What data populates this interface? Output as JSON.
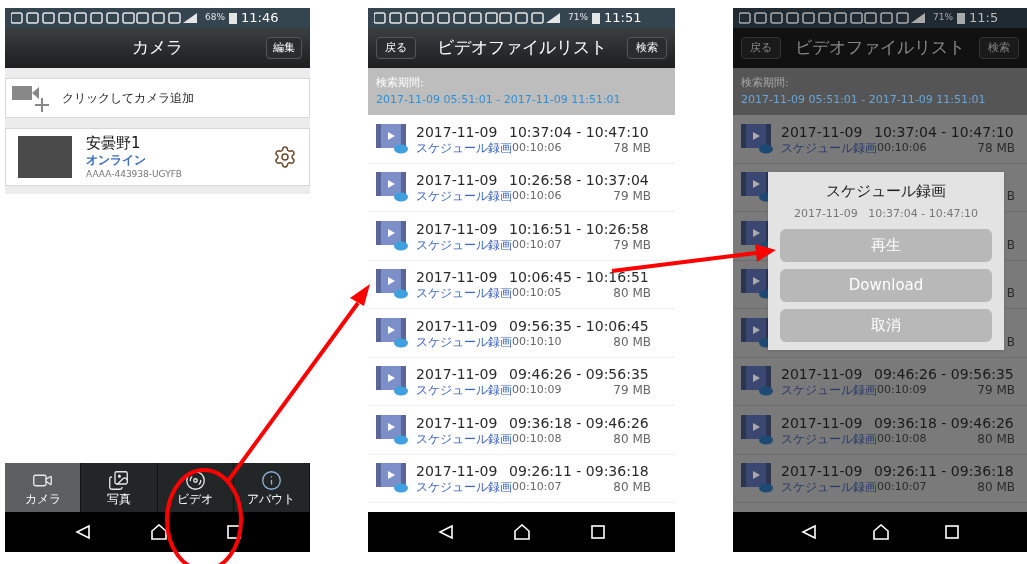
{
  "screens": [
    {
      "kind": "camera_list",
      "status_bar": {
        "battery": "68%",
        "time": "11:46"
      },
      "title": "カメラ",
      "edit_button": "編集",
      "add_camera": "クリックしてカメラ追加",
      "cameras": [
        {
          "name": "安曇野1",
          "status": "オンライン",
          "id": "AAAA-443938-UGYFB"
        }
      ],
      "tabs": [
        {
          "label": "カメラ",
          "selected": true
        },
        {
          "label": "写真",
          "selected": false
        },
        {
          "label": "ビデオ",
          "selected": false
        },
        {
          "label": "アバウト",
          "selected": false
        }
      ]
    },
    {
      "kind": "video_list",
      "dimmed": false,
      "status_bar": {
        "battery": "71%",
        "time": "11:51"
      },
      "back_button": "戻る",
      "title": "ビデオファイルリスト",
      "search_button": "検索",
      "period_label": "検索期間:",
      "period": "2017-11-09 05:51:01 - 2017-11-09 11:51:01",
      "files": [
        {
          "date": "2017-11-09",
          "time": "10:37:04 - 10:47:10",
          "type": "スケジュール録画",
          "duration": "00:10:06",
          "size": "78 MB"
        },
        {
          "date": "2017-11-09",
          "time": "10:26:58 - 10:37:04",
          "type": "スケジュール録画",
          "duration": "00:10:06",
          "size": "79 MB"
        },
        {
          "date": "2017-11-09",
          "time": "10:16:51 - 10:26:58",
          "type": "スケジュール録画",
          "duration": "00:10:07",
          "size": "79 MB"
        },
        {
          "date": "2017-11-09",
          "time": "10:06:45 - 10:16:51",
          "type": "スケジュール録画",
          "duration": "00:10:05",
          "size": "80 MB"
        },
        {
          "date": "2017-11-09",
          "time": "09:56:35 - 10:06:45",
          "type": "スケジュール録画",
          "duration": "00:10:10",
          "size": "80 MB"
        },
        {
          "date": "2017-11-09",
          "time": "09:46:26 - 09:56:35",
          "type": "スケジュール録画",
          "duration": "00:10:09",
          "size": "79 MB"
        },
        {
          "date": "2017-11-09",
          "time": "09:36:18 - 09:46:26",
          "type": "スケジュール録画",
          "duration": "00:10:08",
          "size": "80 MB"
        },
        {
          "date": "2017-11-09",
          "time": "09:26:11 - 09:36:18",
          "type": "スケジュール録画",
          "duration": "00:10:07",
          "size": "80 MB"
        }
      ]
    },
    {
      "kind": "video_list",
      "dimmed": true,
      "status_bar": {
        "battery": "71%",
        "time": "11:5"
      },
      "back_button": "戻る",
      "title": "ビデオファイルリスト",
      "search_button": "検索",
      "period_label": "検索期間:",
      "period": "2017-11-09 05:51:01 - 2017-11-09 11:51:01",
      "files": [
        {
          "date": "2017-11-09",
          "time": "10:37:04 - 10:47:10",
          "type": "スケジュール録画",
          "duration": "00:10:06",
          "size": "78 MB"
        },
        {
          "size": "B"
        },
        {
          "size": "B"
        },
        {
          "size": "B"
        },
        {
          "size": "B"
        },
        {
          "date": "2017-11-09",
          "time": "09:46:26 - 09:56:35",
          "type": "スケジュール録画",
          "duration": "00:10:09",
          "size": "79 MB"
        },
        {
          "date": "2017-11-09",
          "time": "09:36:18 - 09:46:26",
          "type": "スケジュール録画",
          "duration": "00:10:08",
          "size": "80 MB"
        },
        {
          "date": "2017-11-09",
          "time": "09:26:11 - 09:36:18",
          "type": "スケジュール録画",
          "duration": "00:10:07",
          "size": "80 MB"
        }
      ],
      "dialog": {
        "title": "スケジュール録画",
        "subtitle": "2017-11-09   10:37:04 - 10:47:10",
        "buttons": [
          "再生",
          "Download",
          "取消"
        ]
      }
    }
  ]
}
